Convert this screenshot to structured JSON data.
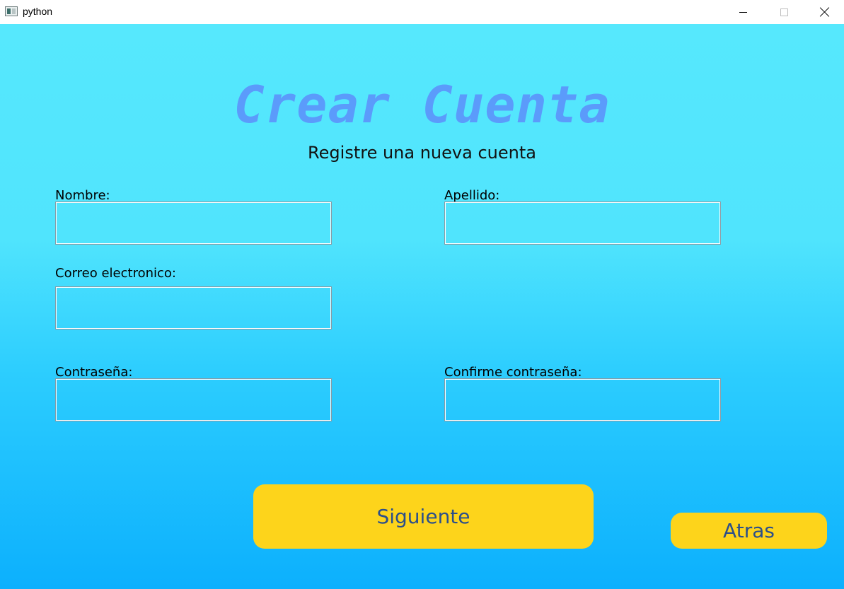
{
  "window": {
    "title": "python",
    "icon": "python-window-icon",
    "controls": [
      "minimize",
      "maximize",
      "close"
    ]
  },
  "form": {
    "heading": "Crear Cuenta",
    "subheading": "Registre una nueva cuenta",
    "fields": {
      "nombre": {
        "label": "Nombre:",
        "value": ""
      },
      "apellido": {
        "label": "Apellido:",
        "value": ""
      },
      "correo": {
        "label": "Correo electronico:",
        "value": ""
      },
      "contrasena": {
        "label": "Contraseña:",
        "value": ""
      },
      "confirmar": {
        "label": "Confirme contraseña:",
        "value": ""
      }
    }
  },
  "buttons": {
    "next": "Siguiente",
    "back": "Atras"
  },
  "colors": {
    "heading": "#5b9bfb",
    "button": "#fdd41b",
    "button_text": "#2c4f8a",
    "background_top": "#56e8fd",
    "background_bottom": "#0cb0fd"
  }
}
